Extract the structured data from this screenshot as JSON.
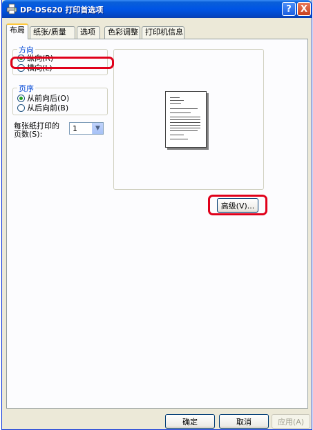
{
  "window": {
    "title": "DP-DS620 打印首选项"
  },
  "titlebar": {
    "help": "?",
    "close": "X"
  },
  "tabs": [
    {
      "label": "布局"
    },
    {
      "label": "纸张/质量"
    },
    {
      "label": "选项"
    },
    {
      "label": "色彩调整"
    },
    {
      "label": "打印机信息"
    }
  ],
  "orientation": {
    "label": "方向",
    "options": [
      {
        "label": "纵向(R)",
        "selected": true
      },
      {
        "label": "横向(L)",
        "selected": false
      }
    ]
  },
  "page_order": {
    "label": "页序",
    "options": [
      {
        "label": "从前向后(O)",
        "selected": true
      },
      {
        "label": "从后向前(B)",
        "selected": false
      }
    ]
  },
  "pages_per_sheet": {
    "label_line1": "每张纸打印的",
    "label_line2": "页数(S):",
    "value": "1"
  },
  "advanced_button": {
    "label": "高级(V)..."
  },
  "footer": {
    "ok": "确定",
    "cancel": "取消",
    "apply": "应用(A)"
  },
  "colors": {
    "titlebar": "#0055e5",
    "dialog_bg": "#ece9d8",
    "group_label": "#0046d5",
    "radio_dot": "#21a121",
    "highlight": "#e0001a",
    "tab_hot": "#ffc83c"
  },
  "icons": {
    "title_icon": "printer-icon",
    "combo_arrow": "chevron-down-icon",
    "preview": "document-page-icon"
  }
}
